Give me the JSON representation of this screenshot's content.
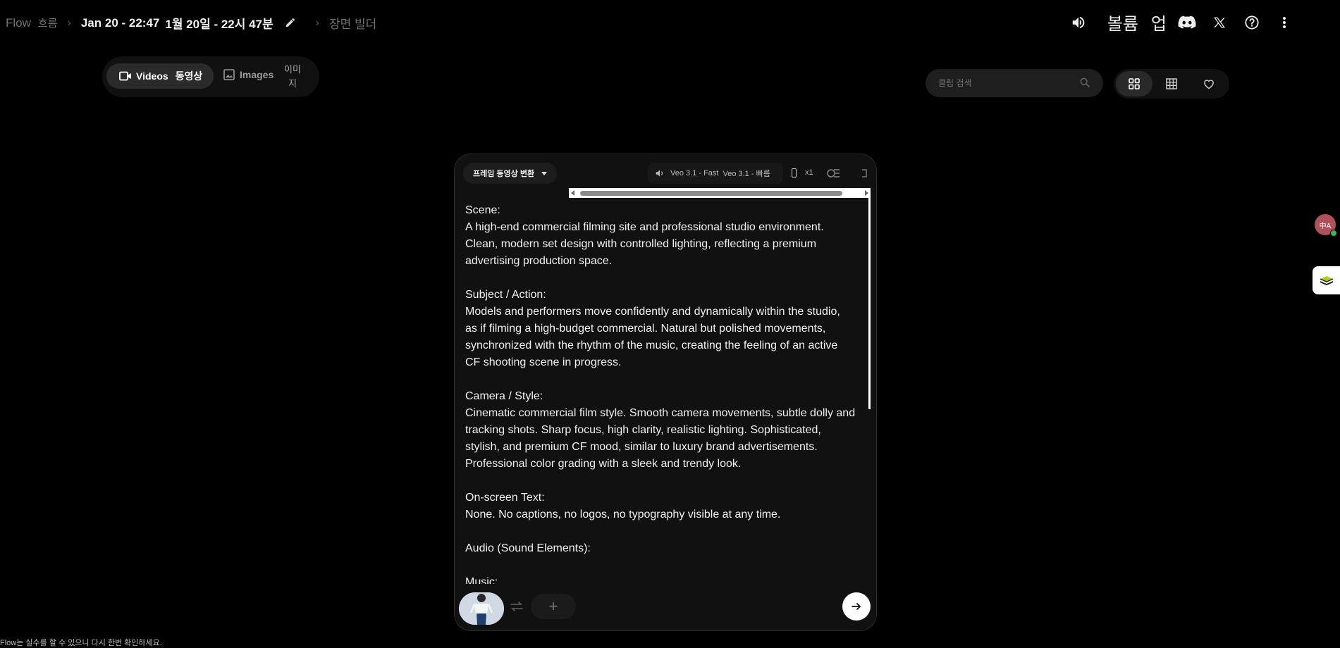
{
  "breadcrumb": {
    "app": "Flow",
    "app_ko": "흐름",
    "project_title": "Jan 20 - 22:47",
    "project_title_ko": "1월 20일 - 22시 47분",
    "scene_builder": "장면 빌더"
  },
  "topbar": {
    "volume_label": "볼륨",
    "up_label": "업"
  },
  "mode_tabs": {
    "videos": "Videos",
    "videos_ko": "동영상",
    "images": "Images",
    "images_ko": "이미지"
  },
  "search": {
    "placeholder": "클립 검색",
    "value": ""
  },
  "composer": {
    "mode_label": "프레임 동영상 변환",
    "model": "Veo 3.1 - Fast",
    "model_ko": "Veo 3.1 - 빠름",
    "output_count": "x1",
    "prompt_lines": [
      "Scene:",
      "A high-end commercial filming site and professional studio environment.",
      "Clean, modern set design with controlled lighting, reflecting a premium",
      "advertising production space.",
      "",
      "Subject / Action:",
      "Models and performers move confidently and dynamically within the studio,",
      "as if filming a high-budget commercial. Natural but polished movements,",
      "synchronized with the rhythm of the music, creating the feeling of an active",
      "CF shooting scene in progress.",
      "",
      "Camera / Style:",
      "Cinematic commercial film style. Smooth camera movements, subtle dolly and",
      "tracking shots. Sharp focus, high clarity, realistic lighting. Sophisticated,",
      "stylish, and premium CF mood, similar to luxury brand advertisements.",
      "Professional color grading with a sleek and trendy look.",
      "",
      "On-screen Text:",
      "None. No captions, no logos, no typography visible at any time.",
      "",
      "Audio (Sound Elements):",
      "",
      "Music:"
    ],
    "add_label": "+"
  },
  "side": {
    "translate_label": "中A"
  },
  "footer": {
    "disclaimer": "Flow는 실수를 할 수 있으니 다시 한번 확인하세요."
  },
  "colors": {
    "background": "#000000",
    "card": "#111111",
    "accent_white": "#ffffff"
  },
  "icons": [
    "pencil-icon",
    "speaker-icon",
    "discord-icon",
    "x-icon",
    "help-icon",
    "more-vert-icon",
    "video-icon",
    "image-icon",
    "search-icon",
    "grid-large-icon",
    "grid-small-icon",
    "heart-icon",
    "swap-icon",
    "arrow-right-icon"
  ]
}
